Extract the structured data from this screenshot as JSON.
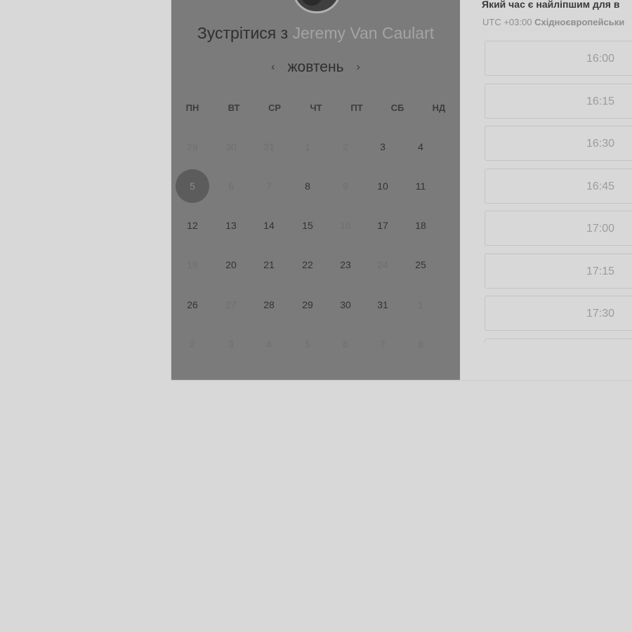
{
  "scheduler": {
    "title_prefix": "Зустрітися з",
    "host_name": "Jeremy Van Caulart",
    "month": "жовтень",
    "prev_arrow": "‹",
    "next_arrow": "›",
    "weekdays": [
      "ПН",
      "ВТ",
      "СР",
      "ЧТ",
      "ПТ",
      "СБ",
      "НД"
    ],
    "weeks": [
      [
        {
          "d": "29",
          "s": "off"
        },
        {
          "d": "30",
          "s": "off"
        },
        {
          "d": "31",
          "s": "off"
        },
        {
          "d": "1",
          "s": "off"
        },
        {
          "d": "2",
          "s": "off"
        },
        {
          "d": "3",
          "s": "avail"
        },
        {
          "d": "4",
          "s": "avail"
        }
      ],
      [
        {
          "d": "5",
          "s": "selected"
        },
        {
          "d": "6",
          "s": "off"
        },
        {
          "d": "7",
          "s": "off"
        },
        {
          "d": "8",
          "s": "avail"
        },
        {
          "d": "9",
          "s": "off"
        },
        {
          "d": "10",
          "s": "avail"
        },
        {
          "d": "11",
          "s": "avail"
        }
      ],
      [
        {
          "d": "12",
          "s": "avail"
        },
        {
          "d": "13",
          "s": "avail"
        },
        {
          "d": "14",
          "s": "avail"
        },
        {
          "d": "15",
          "s": "avail"
        },
        {
          "d": "16",
          "s": "off"
        },
        {
          "d": "17",
          "s": "avail"
        },
        {
          "d": "18",
          "s": "avail"
        }
      ],
      [
        {
          "d": "19",
          "s": "off"
        },
        {
          "d": "20",
          "s": "avail"
        },
        {
          "d": "21",
          "s": "avail"
        },
        {
          "d": "22",
          "s": "avail"
        },
        {
          "d": "23",
          "s": "avail"
        },
        {
          "d": "24",
          "s": "off"
        },
        {
          "d": "25",
          "s": "avail"
        }
      ],
      [
        {
          "d": "26",
          "s": "avail"
        },
        {
          "d": "27",
          "s": "off"
        },
        {
          "d": "28",
          "s": "avail"
        },
        {
          "d": "29",
          "s": "avail"
        },
        {
          "d": "30",
          "s": "avail"
        },
        {
          "d": "31",
          "s": "avail"
        },
        {
          "d": "1",
          "s": "off"
        }
      ],
      [
        {
          "d": "2",
          "s": "off"
        },
        {
          "d": "3",
          "s": "off"
        },
        {
          "d": "4",
          "s": "off"
        },
        {
          "d": "5",
          "s": "off"
        },
        {
          "d": "6",
          "s": "off"
        },
        {
          "d": "7",
          "s": "off"
        },
        {
          "d": "8",
          "s": "off"
        }
      ]
    ]
  },
  "times": {
    "question": "Який час є найліпшим для в",
    "tz_offset": "UTC +03:00",
    "tz_name": "Східноєвропейськи",
    "slots": [
      "16:00",
      "16:15",
      "16:30",
      "16:45",
      "17:00",
      "17:15",
      "17:30",
      ""
    ]
  },
  "colors": {
    "overlay_panel": "#7b7b7b",
    "page_background": "#d8d8d8",
    "selected_day": "#5c5c5c"
  }
}
